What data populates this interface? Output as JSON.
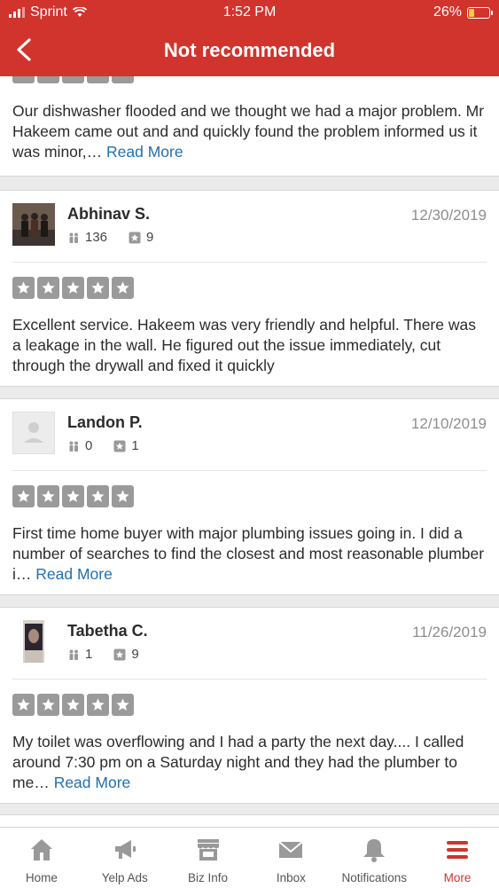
{
  "status": {
    "carrier": "Sprint",
    "time": "1:52 PM",
    "battery": "26%"
  },
  "header": {
    "title": "Not recommended"
  },
  "colors": {
    "brand": "#d0342c",
    "link": "#1f6fb2",
    "star_gray": "#9a9a9a"
  },
  "reviews": [
    {
      "text": "Our dishwasher flooded and we thought we had a major problem. Mr Hakeem came out and and quickly found the problem informed us it was minor,…",
      "read_more": "Read More"
    },
    {
      "name": "Abhinav S.",
      "date": "12/30/2019",
      "friends": "136",
      "reviews": "9",
      "text": "Excellent service. Hakeem was very friendly and helpful. There was a leakage in the wall. He figured out the issue immediately, cut through the drywall and fixed it quickly",
      "read_more": ""
    },
    {
      "name": "Landon P.",
      "date": "12/10/2019",
      "friends": "0",
      "reviews": "1",
      "text": "First time home buyer with major plumbing issues going in. I did a number of searches to find the closest and most reasonable plumber i…",
      "read_more": "Read More"
    },
    {
      "name": "Tabetha C.",
      "date": "11/26/2019",
      "friends": "1",
      "reviews": "9",
      "text": "My toilet was overflowing and I had a party the next day.... I called around 7:30 pm on a Saturday night and they had the plumber to me…",
      "read_more": "Read More"
    }
  ],
  "tabs": [
    {
      "label": "Home",
      "icon": "home-icon"
    },
    {
      "label": "Yelp Ads",
      "icon": "megaphone-icon"
    },
    {
      "label": "Biz Info",
      "icon": "storefront-icon"
    },
    {
      "label": "Inbox",
      "icon": "envelope-icon"
    },
    {
      "label": "Notifications",
      "icon": "bell-icon"
    },
    {
      "label": "More",
      "icon": "menu-icon"
    }
  ]
}
